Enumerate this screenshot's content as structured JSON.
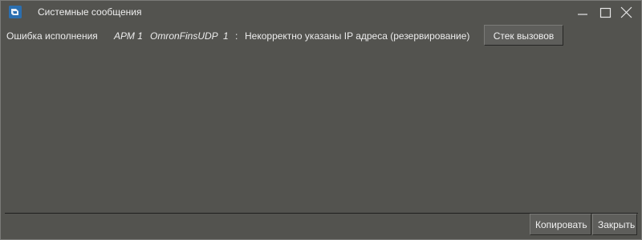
{
  "window": {
    "title": "Системные сообщения"
  },
  "message": {
    "type": "Ошибка исполнения",
    "station": "АРМ 1",
    "driver": "OmronFinsUDP",
    "number": "1",
    "separator": ":",
    "text": "Некорректно указаны IP адреса (резервирование)"
  },
  "buttons": {
    "stack": "Стек вызовов",
    "copy": "Копировать",
    "close": "Закрыть"
  },
  "colors": {
    "background": "#53534f",
    "text": "#ececec",
    "app_icon": "#2b6fb0"
  },
  "icons": {
    "app": "app-icon",
    "minimize": "minimize-icon",
    "maximize": "maximize-icon",
    "close": "close-icon"
  }
}
